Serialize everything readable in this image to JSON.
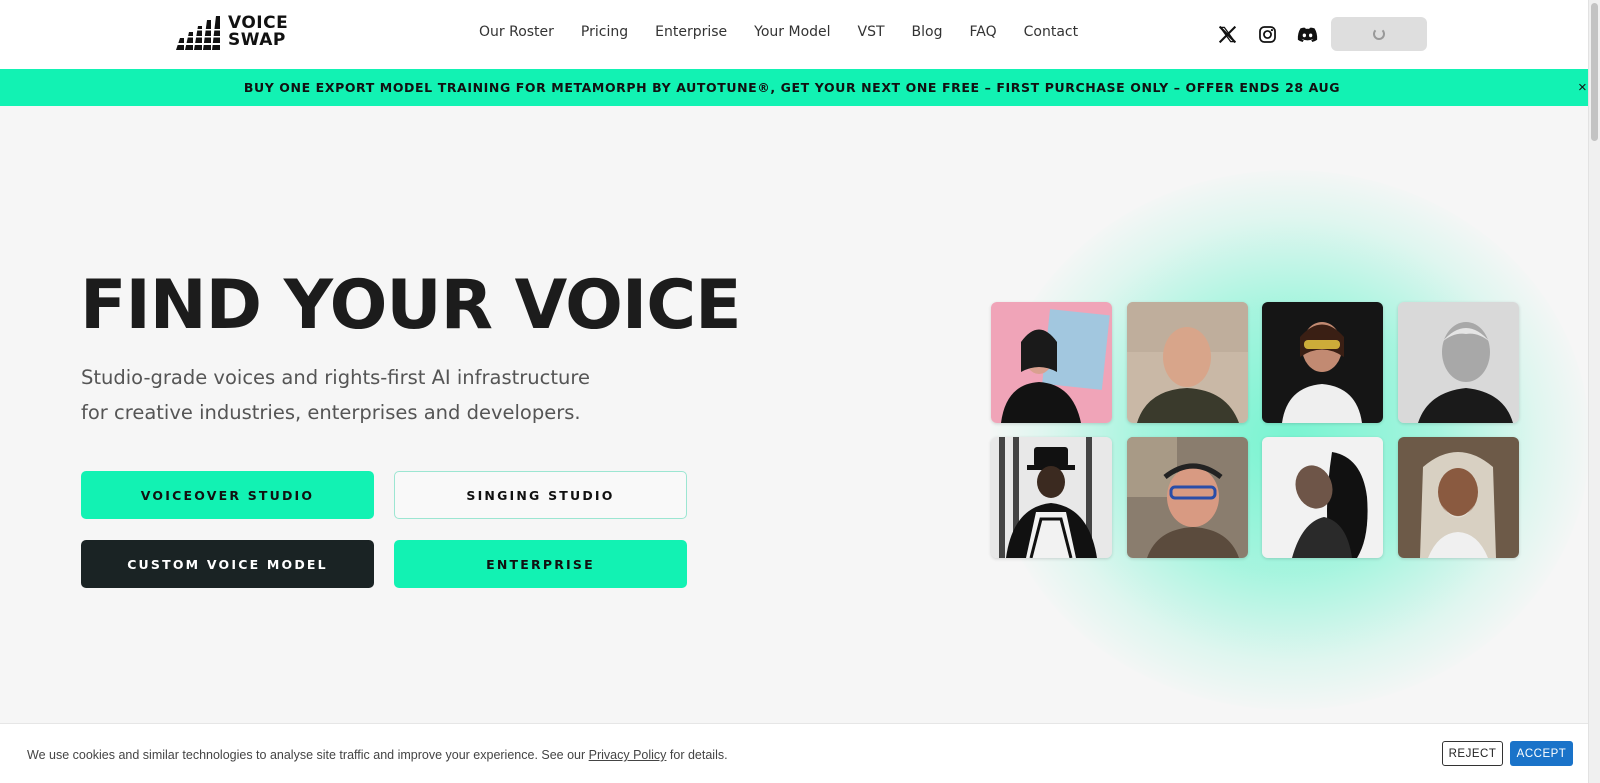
{
  "header": {
    "logo_line1": "VOICE",
    "logo_line2": "SWAP",
    "nav": [
      "Our Roster",
      "Pricing",
      "Enterprise",
      "Your Model",
      "VST",
      "Blog",
      "FAQ",
      "Contact"
    ],
    "social": [
      "x-icon",
      "instagram-icon",
      "discord-icon"
    ]
  },
  "promo": {
    "text": "BUY ONE EXPORT MODEL TRAINING FOR METAMORPH BY AUTOTUNE®, GET YOUR NEXT ONE FREE – FIRST PURCHASE ONLY – OFFER ENDS 28 AUG",
    "close": "×"
  },
  "hero": {
    "title": "FIND YOUR VOICE",
    "subtitle": "Studio-grade voices and rights-first AI infrastructure for creative industries, enterprises and developers.",
    "buttons": {
      "voiceover": "VOICEOVER STUDIO",
      "singing": "SINGING STUDIO",
      "custom": "CUSTOM VOICE MODEL",
      "enterprise": "ENTERPRISE"
    }
  },
  "portraits": [
    {
      "name": "portrait-1",
      "bg": "#f0a4b8"
    },
    {
      "name": "portrait-2",
      "bg": "#c9b8a6"
    },
    {
      "name": "portrait-3",
      "bg": "#151515"
    },
    {
      "name": "portrait-4",
      "bg": "#d9d9d9"
    },
    {
      "name": "portrait-5",
      "bg": "#e8e8e8"
    },
    {
      "name": "portrait-6",
      "bg": "#8a7d6e"
    },
    {
      "name": "portrait-7",
      "bg": "#f2f2f2"
    },
    {
      "name": "portrait-8",
      "bg": "#6d5a48"
    }
  ],
  "cookie": {
    "text_before": "We use cookies and similar technologies to analyse site traffic and improve your experience. See our ",
    "link": "Privacy Policy",
    "text_after": " for details.",
    "reject": "REJECT",
    "accept": "ACCEPT"
  },
  "colors": {
    "accent": "#12f2b3",
    "dark_button": "#1a2324",
    "accept_button": "#1a73c9"
  }
}
